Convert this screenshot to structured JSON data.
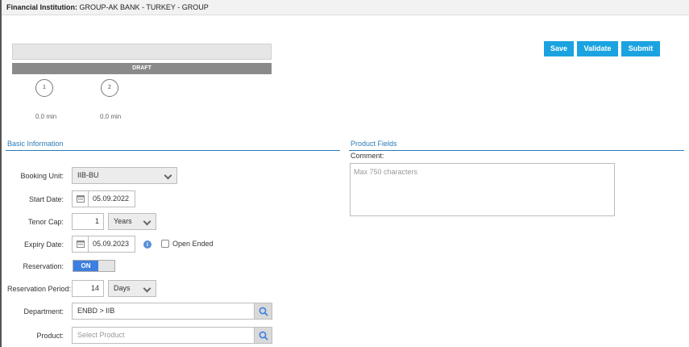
{
  "header": {
    "institution_label": "Financial Institution:",
    "institution_value": "GROUP-AK BANK - TURKEY - GROUP"
  },
  "workflow": {
    "status": "DRAFT",
    "steps": [
      {
        "number": "1",
        "time": "0.0 min"
      },
      {
        "number": "2",
        "time": "0.0 min"
      }
    ]
  },
  "actions": {
    "save": "Save",
    "validate": "Validate",
    "submit": "Submit"
  },
  "basic_info": {
    "title": "Basic Information",
    "booking_unit": {
      "label": "Booking Unit:",
      "value": "IIB-BU"
    },
    "start_date": {
      "label": "Start Date:",
      "value": "05.09.2022"
    },
    "tenor_cap": {
      "label": "Tenor Cap:",
      "value": "1",
      "unit": "Years"
    },
    "expiry_date": {
      "label": "Expiry Date:",
      "value": "05.09.2023",
      "open_ended_label": "Open Ended",
      "open_ended_checked": false
    },
    "reservation": {
      "label": "Reservation:",
      "value": "ON"
    },
    "reservation_period": {
      "label": "Reservation Period:",
      "value": "14",
      "unit": "Days"
    },
    "department": {
      "label": "Department:",
      "value": "ENBD > IIB"
    },
    "product": {
      "label": "Product:",
      "placeholder": "Select Product"
    }
  },
  "product_fields": {
    "title": "Product Fields",
    "comment_label": "Comment:",
    "comment_placeholder": "Max 750 characters"
  },
  "colors": {
    "accent": "#1aa3e0",
    "section": "#2a7ab8",
    "toggle_on": "#3d7fe0",
    "status_bar": "#8a8a8a"
  }
}
